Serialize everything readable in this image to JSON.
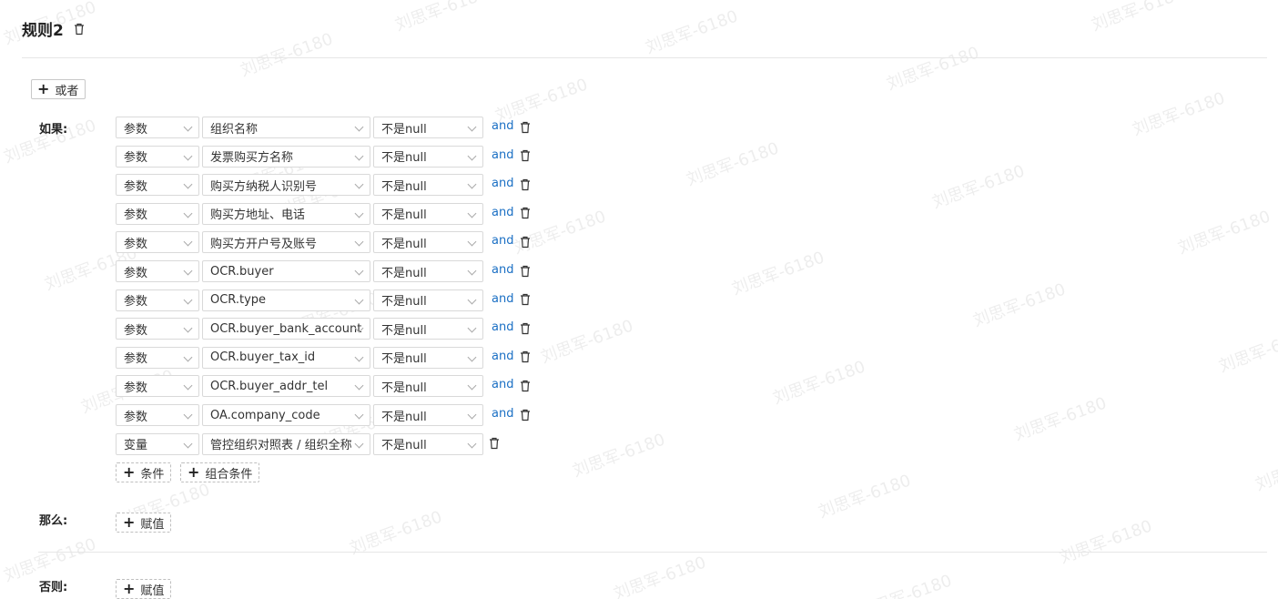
{
  "rule": {
    "title": "规则2"
  },
  "or_button": {
    "label": "或者"
  },
  "labels": {
    "if": "如果:",
    "then": "那么:",
    "else": "否则:"
  },
  "watermark": "刘思军-6180",
  "conditions": [
    {
      "type": "参数",
      "field": "组织名称",
      "operator": "不是null",
      "connector": "and"
    },
    {
      "type": "参数",
      "field": "发票购买方名称",
      "operator": "不是null",
      "connector": "and"
    },
    {
      "type": "参数",
      "field": "购买方纳税人识别号",
      "operator": "不是null",
      "connector": "and"
    },
    {
      "type": "参数",
      "field": "购买方地址、电话",
      "operator": "不是null",
      "connector": "and"
    },
    {
      "type": "参数",
      "field": "购买方开户号及账号",
      "operator": "不是null",
      "connector": "and"
    },
    {
      "type": "参数",
      "field": "OCR.buyer",
      "operator": "不是null",
      "connector": "and"
    },
    {
      "type": "参数",
      "field": "OCR.type",
      "operator": "不是null",
      "connector": "and"
    },
    {
      "type": "参数",
      "field": "OCR.buyer_bank_account",
      "operator": "不是null",
      "connector": "and"
    },
    {
      "type": "参数",
      "field": "OCR.buyer_tax_id",
      "operator": "不是null",
      "connector": "and"
    },
    {
      "type": "参数",
      "field": "OCR.buyer_addr_tel",
      "operator": "不是null",
      "connector": "and"
    },
    {
      "type": "参数",
      "field": "OA.company_code",
      "operator": "不是null",
      "connector": "and"
    },
    {
      "type": "变量",
      "field": "管控组织对照表 / 组织全称",
      "operator": "不是null",
      "connector": ""
    }
  ],
  "add_condition": {
    "label": "条件"
  },
  "add_group_condition": {
    "label": "组合条件"
  },
  "then_assign": {
    "label": "赋值"
  },
  "else_assign": {
    "label": "赋值"
  }
}
